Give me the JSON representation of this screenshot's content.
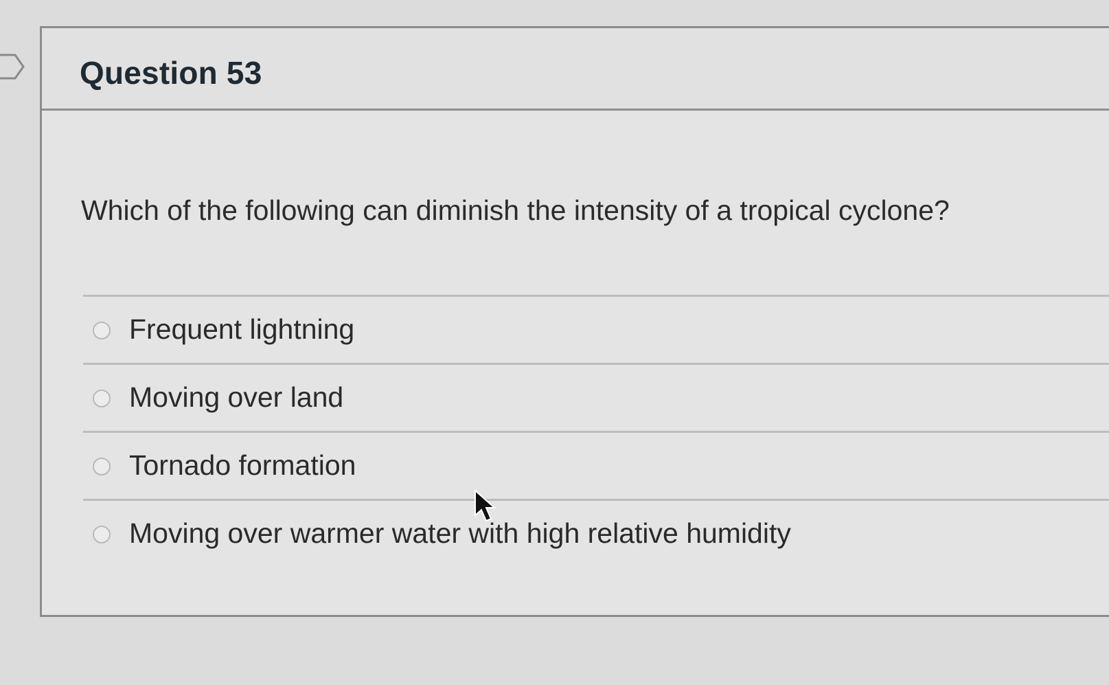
{
  "question": {
    "title": "Question 53",
    "text": "Which of the following can diminish the intensity of a tropical cyclone?",
    "answers": [
      {
        "label": "Frequent lightning",
        "selected": false
      },
      {
        "label": "Moving over land",
        "selected": false
      },
      {
        "label": "Tornado formation",
        "selected": false
      },
      {
        "label": "Moving over warmer water with high relative humidity",
        "selected": false
      }
    ]
  },
  "icons": {
    "flag": "flag-marker-icon",
    "radio": "radio-button-icon",
    "cursor": "mouse-pointer-icon"
  },
  "colors": {
    "background": "#dcdcdc",
    "card": "#e4e4e4",
    "border": "#8c8c8c",
    "text": "#2b2b2b"
  }
}
